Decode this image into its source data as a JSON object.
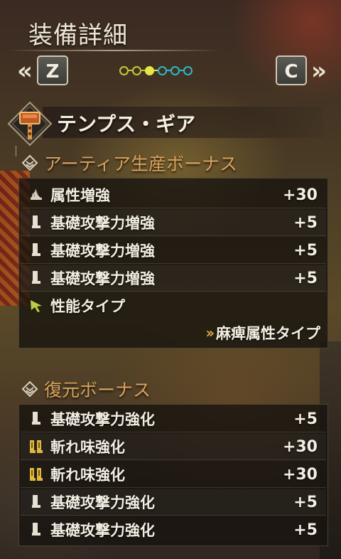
{
  "header": {
    "title": "装備詳細",
    "nav_left_arrow": "«",
    "nav_right_arrow": "»",
    "key_left": "Z",
    "key_right": "C",
    "page_dots": [
      {
        "color": "#c8c83a",
        "filled": false
      },
      {
        "color": "#c8c83a",
        "filled": false
      },
      {
        "color": "#e6e64a",
        "filled": true
      },
      {
        "color": "#2fb8c8",
        "filled": false
      },
      {
        "color": "#2fb8c8",
        "filled": false
      },
      {
        "color": "#2fb8c8",
        "filled": false
      }
    ]
  },
  "equipment": {
    "name": "テンプス・ギア",
    "icon": "hammer-weapon-icon"
  },
  "artian_bonus": {
    "title": "アーティア生産ボーナス",
    "icon": "bonus-diamond-icon",
    "rows": [
      {
        "label": "属性増強",
        "value": "+30",
        "icon": "element-claw-icon"
      },
      {
        "label": "基礎攻撃力増強",
        "value": "+5",
        "icon": "attack-blade-icon"
      },
      {
        "label": "基礎攻撃力増強",
        "value": "+5",
        "icon": "attack-blade-icon"
      },
      {
        "label": "基礎攻撃力増強",
        "value": "+5",
        "icon": "attack-blade-icon"
      },
      {
        "label": "性能タイプ",
        "value": "",
        "icon": "type-arrow-icon"
      }
    ],
    "type_value": "麻痺属性タイプ",
    "type_chevron": "»"
  },
  "restore_bonus": {
    "title": "復元ボーナス",
    "icon": "bonus-diamond-icon",
    "rows": [
      {
        "label": "基礎攻撃力強化",
        "value": "+5",
        "icon": "attack-blade-icon"
      },
      {
        "label": "斬れ味強化",
        "value": "+30",
        "icon": "sharpness-icon"
      },
      {
        "label": "斬れ味強化",
        "value": "+30",
        "icon": "sharpness-icon"
      },
      {
        "label": "基礎攻撃力強化",
        "value": "+5",
        "icon": "attack-blade-icon"
      },
      {
        "label": "基礎攻撃力強化",
        "value": "+5",
        "icon": "attack-blade-icon"
      }
    ]
  },
  "colors": {
    "section_title": "#d9a25c",
    "text": "#f2eee2",
    "accent_yellow": "#e6e64a",
    "accent_cyan": "#2fb8c8"
  }
}
